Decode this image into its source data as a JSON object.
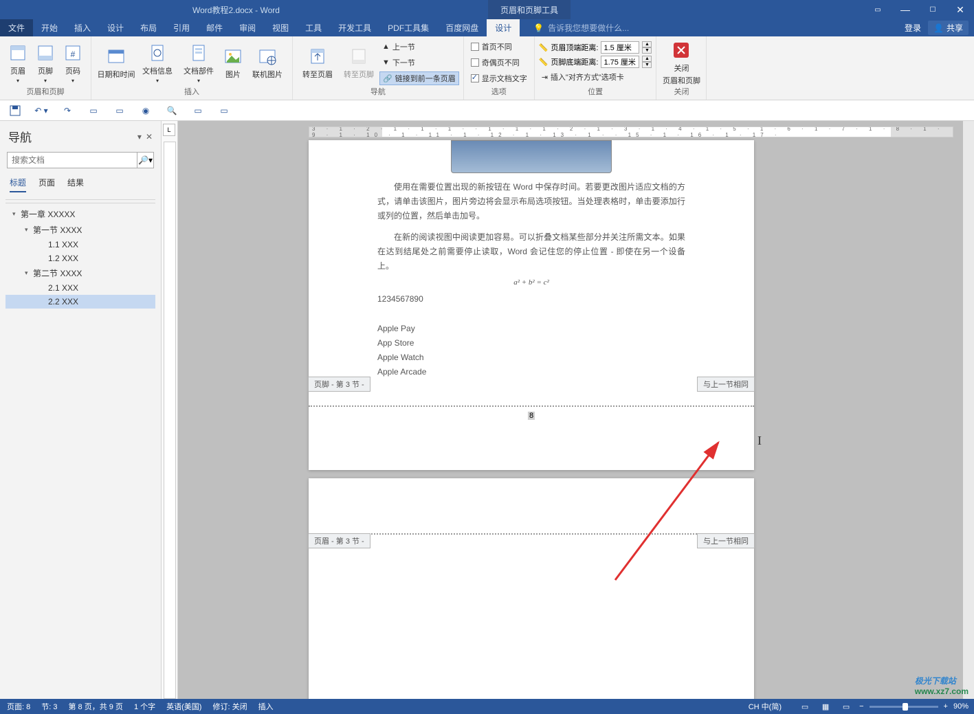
{
  "titlebar": {
    "document_title": "Word教程2.docx - Word",
    "contextual_tab_group": "页眉和页脚工具"
  },
  "menutabs": {
    "items": [
      "文件",
      "开始",
      "插入",
      "设计",
      "布局",
      "引用",
      "邮件",
      "审阅",
      "视图",
      "工具",
      "开发工具",
      "PDF工具集",
      "百度网盘"
    ],
    "contextual_active": "设计",
    "tell_me_placeholder": "告诉我您想要做什么...",
    "login": "登录",
    "share": "共享"
  },
  "ribbon": {
    "group1": {
      "header": "页眉",
      "footer": "页脚",
      "pagenum": "页码",
      "label": "页眉和页脚"
    },
    "group2": {
      "datetime": "日期和时间",
      "docinfo": "文档信息",
      "docparts": "文档部件",
      "picture": "图片",
      "onlinepic": "联机图片",
      "label": "插入"
    },
    "group3": {
      "goto_header": "转至页眉",
      "goto_footer": "转至页脚",
      "prev": "上一节",
      "next": "下一节",
      "link_prev": "链接到前一条页眉",
      "label": "导航"
    },
    "group4": {
      "first_diff": "首页不同",
      "odd_even": "奇偶页不同",
      "show_text": "显示文档文字",
      "label": "选项"
    },
    "group5": {
      "top_label": "页眉顶端距离:",
      "top_val": "1.5 厘米",
      "bottom_label": "页脚底端距离:",
      "bottom_val": "1.75 厘米",
      "insert_align": "插入\"对齐方式\"选项卡",
      "label": "位置"
    },
    "group6": {
      "close1": "关闭",
      "close2": "页眉和页脚",
      "label": "关闭"
    }
  },
  "navpane": {
    "title": "导航",
    "search_placeholder": "搜索文档",
    "tabs": [
      "标题",
      "页面",
      "结果"
    ],
    "tree": [
      {
        "level": 0,
        "caret": "▾",
        "text": "第一章 XXXXX"
      },
      {
        "level": 1,
        "caret": "▾",
        "text": "第一节 XXXX"
      },
      {
        "level": 2,
        "text": "1.1 XXX"
      },
      {
        "level": 2,
        "text": "1.2 XXX"
      },
      {
        "level": 1,
        "caret": "▾",
        "text": "第二节 XXXX"
      },
      {
        "level": 2,
        "text": "2.1 XXX"
      },
      {
        "level": 2,
        "text": "2.2 XXX",
        "selected": true
      }
    ]
  },
  "ruler": {
    "horizontal": "3 · 1 · 2 · 1 · 1 · 1 ·   · 1 · 1 · 1 · 2 · 1 · 3 · 1 · 4 · 1 · 5 · 1 · 6 · 1 · 7 · 1 · 8 · 1 · 9 · 1 · 10 · 1 · 11 · 1 · 12 · 1 · 13 · 1 ·   · 15 · 1 · 16 · 1 · 17 ·"
  },
  "document": {
    "para1": "使用在需要位置出现的新按钮在 Word 中保存时间。若要更改图片适应文档的方式，请单击该图片，图片旁边将会显示布局选项按钮。当处理表格时，单击要添加行或列的位置，然后单击加号。",
    "para2": "在新的阅读视图中阅读更加容易。可以折叠文档某些部分并关注所需文本。如果在达到结尾处之前需要停止读取，Word 会记住您的停止位置 - 即使在另一个设备上。",
    "formula": "a² + b² = c²",
    "digits": "1234567890",
    "list": [
      "Apple Pay",
      "App Store",
      "Apple Watch",
      "Apple Arcade"
    ],
    "footer_label": "页脚 - 第 3 节 -",
    "same_as_prev": "与上一节相同",
    "header_label": "页眉 - 第 3 节 -",
    "page_num": "8"
  },
  "statusbar": {
    "page": "页面: 8",
    "section": "节: 3",
    "page_of": "第 8 页，共 9 页",
    "words": "1 个字",
    "lang": "英语(美国)",
    "track": "修订: 关闭",
    "insert": "插入",
    "zoom": "90%",
    "ime": "CH 中(简)"
  },
  "watermark": {
    "top": "极光下载站",
    "bottom": "www.xz7.com"
  }
}
